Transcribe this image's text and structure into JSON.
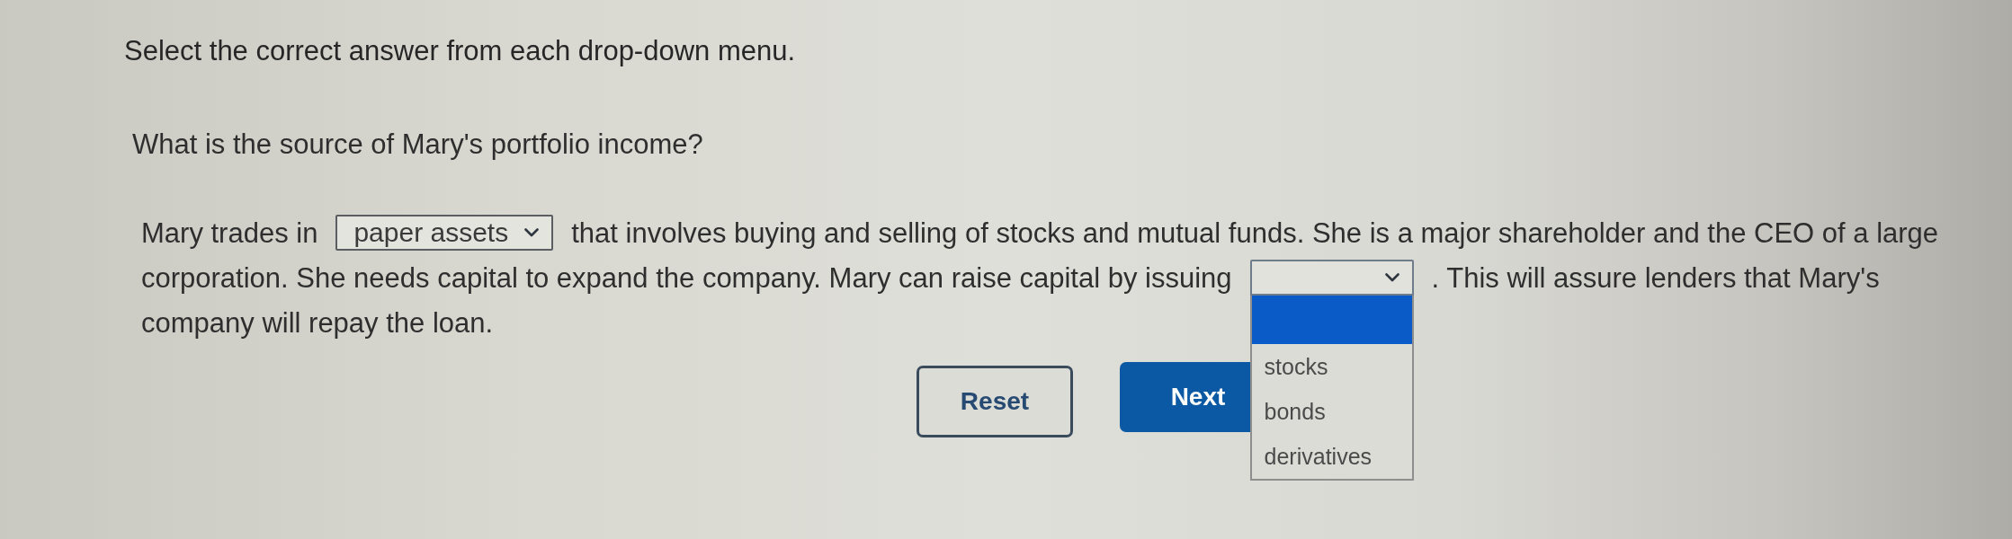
{
  "instructions": "Select the correct answer from each drop-down menu.",
  "question": "What is the source of Mary's portfolio income?",
  "passage": {
    "lines": [
      [
        {
          "kind": "text",
          "text": "Mary trades in"
        },
        {
          "kind": "dropdown",
          "value": "paper assets",
          "expanded": false
        },
        {
          "kind": "text",
          "text": "that involves buying and selling of stocks and mutual funds. She is a major shareholder and the CEO of a large"
        }
      ],
      [
        {
          "kind": "text",
          "text": "corporation. She needs capital to expand the company. Mary can raise capital by issuing"
        },
        {
          "kind": "dropdown",
          "expanded": true,
          "options": [
            {
              "selected": true
            },
            {
              "label": "stocks",
              "selected": false
            },
            {
              "label": "bonds",
              "selected": false
            },
            {
              "label": "derivatives",
              "selected": false
            }
          ]
        },
        {
          "kind": "text",
          "text": ". This will assure lenders that Mary's"
        }
      ],
      [
        {
          "kind": "text",
          "text": "company will repay the loan."
        }
      ]
    ]
  },
  "buttons": [
    {
      "kind": "secondary",
      "label": "Reset"
    },
    {
      "kind": "primary",
      "label": "Next"
    }
  ]
}
